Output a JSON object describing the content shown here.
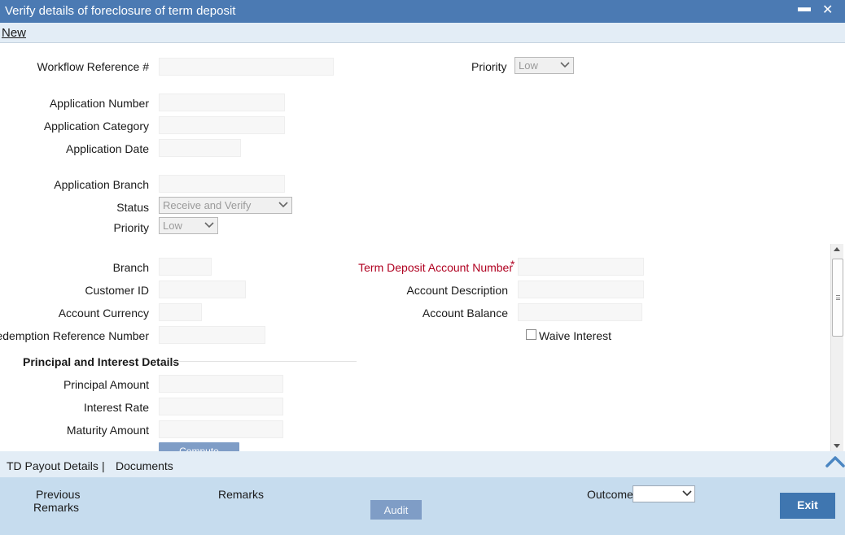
{
  "window": {
    "title": "Verify details of foreclosure of term deposit",
    "minimize_glyph": "▬",
    "close_glyph": "✕"
  },
  "menu": {
    "new_label": "New"
  },
  "form": {
    "workflow_reference_label": "Workflow Reference #",
    "priority_top_label": "Priority",
    "priority_top_value": "Low",
    "application_number_label": "Application Number",
    "application_category_label": "Application Category",
    "application_date_label": "Application Date",
    "application_branch_label": "Application Branch",
    "status_label": "Status",
    "status_value": "Receive and Verify",
    "priority_label": "Priority",
    "priority_value": "Low",
    "branch_label": "Branch",
    "customer_id_label": "Customer ID",
    "account_currency_label": "Account Currency",
    "redemption_reference_label": "Redemption Reference Number",
    "td_account_number_label": "Term Deposit Account Number",
    "required_marker": "*",
    "account_description_label": "Account Description",
    "account_balance_label": "Account Balance",
    "waive_interest_label": "Waive Interest",
    "principal_section_title": "Principal and Interest Details",
    "principal_amount_label": "Principal Amount",
    "interest_rate_label": "Interest Rate",
    "maturity_amount_label": "Maturity Amount",
    "compute_label": "Compute"
  },
  "tabs": {
    "td_payout_label": "TD Payout Details",
    "separator": "|",
    "documents_label": "Documents"
  },
  "footer": {
    "previous_remarks_line1": "Previous",
    "previous_remarks_line2": "Remarks",
    "remarks_label": "Remarks",
    "audit_label": "Audit",
    "outcome_label": "Outcome",
    "exit_label": "Exit"
  },
  "colors": {
    "titlebar": "#4b7ab3",
    "menubar": "#e3edf6",
    "footer": "#c6dcee",
    "required_text": "#b00020",
    "button": "#3f76b0"
  }
}
